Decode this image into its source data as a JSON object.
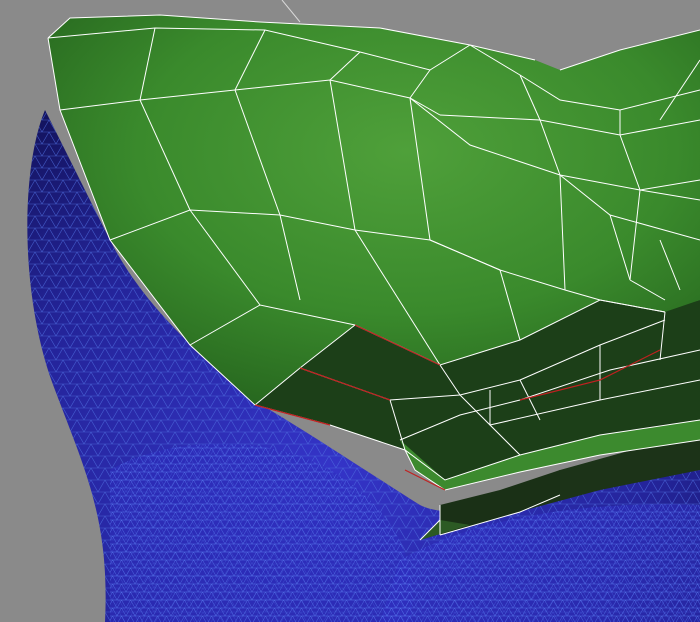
{
  "viewport": {
    "background_color": "#8a8a8a",
    "colors": {
      "highpoly_mesh": "#2a2aa8",
      "highpoly_wire": "#4f6fe0",
      "lowpoly_surface": "#3f8f2f",
      "lowpoly_shadow": "#132612",
      "wire_edge": "#ffffff",
      "seam_edge": "#c02020"
    }
  }
}
